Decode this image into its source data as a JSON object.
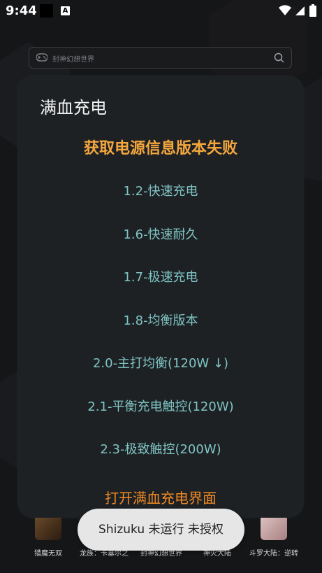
{
  "status_bar": {
    "time": "9:44",
    "notification_icon_letter": "A"
  },
  "search": {
    "placeholder": "封神幻想世界"
  },
  "dialog": {
    "title": "满血充电",
    "error": "获取电源信息版本失败",
    "options": [
      "1.2-快速充电",
      "1.6-快速耐久",
      "1.7-极速充电",
      "1.8-均衡版本",
      "2.0-主打均衡(120W ↓)",
      "2.1-平衡充电触控(120W)",
      "2.3-极致触控(200W)"
    ],
    "open_button": "打开满血充电界面"
  },
  "games": [
    {
      "name": "猎魔无双",
      "color": "#5b3b22"
    },
    {
      "name": "龙族：卡塞尔之",
      "color": "#4a3c30"
    },
    {
      "name": "封神幻想世界",
      "color": "#3d3a40"
    },
    {
      "name": "神火大陆",
      "color": "#5a4030"
    },
    {
      "name": "斗罗大陆：逆转",
      "color": "#d7b7b7"
    }
  ],
  "toast": {
    "message": "Shizuku 未运行 未授权"
  },
  "colors": {
    "background": "#151618",
    "dialog": "#1e2124",
    "option_text": "#7fc4c4",
    "error_text": "#f4a63d",
    "open_button_text": "#f08a24"
  }
}
